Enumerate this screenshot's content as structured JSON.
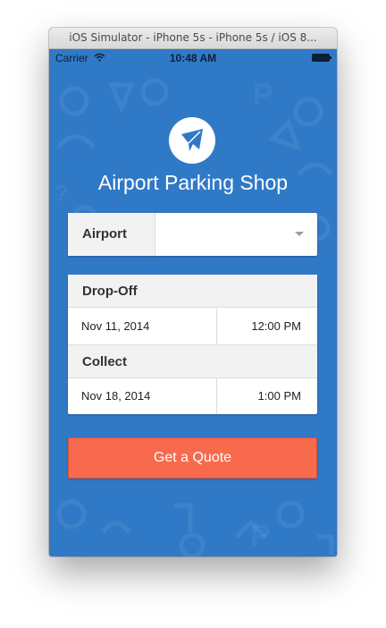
{
  "window": {
    "title": "iOS Simulator - iPhone 5s - iPhone 5s / iOS 8..."
  },
  "status_bar": {
    "carrier": "Carrier",
    "time": "10:48 AM",
    "wifi_icon": "wifi-icon",
    "battery_icon": "battery-icon"
  },
  "app": {
    "title": "Airport Parking Shop",
    "logo_icon": "paper-plane-logo-icon"
  },
  "airport": {
    "label": "Airport",
    "value": ""
  },
  "dropoff": {
    "heading": "Drop-Off",
    "date": "Nov 11, 2014",
    "time": "12:00 PM"
  },
  "collect": {
    "heading": "Collect",
    "date": "Nov 18, 2014",
    "time": "1:00 PM"
  },
  "actions": {
    "quote_label": "Get a Quote"
  },
  "colors": {
    "background": "#3079c6",
    "button": "#f76a4d",
    "card": "#ffffff",
    "header": "#f2f2f2"
  }
}
